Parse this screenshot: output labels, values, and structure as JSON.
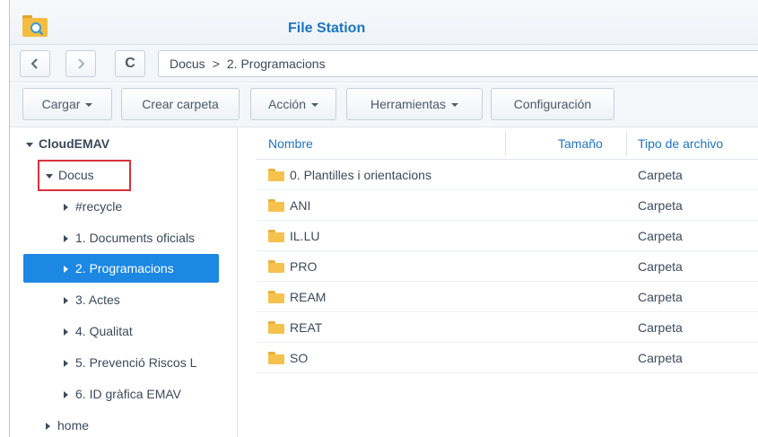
{
  "window": {
    "title": "File Station",
    "app_icon": "file-station-folder-icon"
  },
  "nav": {
    "back_icon": "chevron-left-icon",
    "forward_icon": "chevron-right-icon",
    "refresh_icon": "refresh-icon",
    "refresh_glyph": "C",
    "path": [
      "Docus",
      "2. Programacions"
    ],
    "path_separator": ">"
  },
  "toolbar": {
    "upload": "Cargar",
    "create_folder": "Crear carpeta",
    "action": "Acción",
    "tools": "Herramientas",
    "settings": "Configuración"
  },
  "sidebar": {
    "root": "CloudEMAV",
    "docus": "Docus",
    "children": [
      "#recycle",
      "1. Documents oficials",
      "2. Programacions",
      "3. Actes",
      "4. Qualitat",
      "5. Prevenció Riscos L",
      "6. ID gràfica EMAV"
    ],
    "selected": "2. Programacions",
    "home": "home"
  },
  "filelist": {
    "columns": {
      "name": "Nombre",
      "size": "Tamaño",
      "type": "Tipo de archivo"
    },
    "rows": [
      {
        "name": "0. Plantilles i orientacions",
        "type": "Carpeta"
      },
      {
        "name": "ANI",
        "type": "Carpeta"
      },
      {
        "name": "IL.LU",
        "type": "Carpeta"
      },
      {
        "name": "PRO",
        "type": "Carpeta"
      },
      {
        "name": "REAM",
        "type": "Carpeta"
      },
      {
        "name": "REAT",
        "type": "Carpeta"
      },
      {
        "name": "SO",
        "type": "Carpeta"
      }
    ]
  },
  "colors": {
    "accent": "#1e74c5",
    "selected_bg": "#1c88e4",
    "highlight_border": "#d8323c",
    "folder": "#f6c24e"
  }
}
